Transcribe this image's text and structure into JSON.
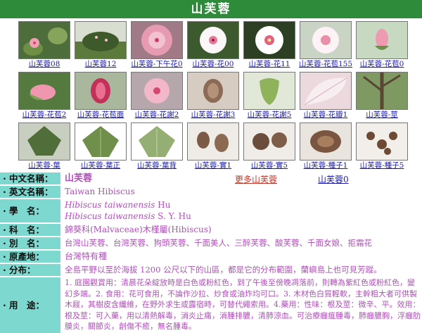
{
  "title": "山芙蓉",
  "gallery": {
    "row1": [
      "山芙蓉08",
      "山芙蓉12",
      "山芙蓉-下午花0",
      "山芙蓉-花00",
      "山芙蓉-花11",
      "山芙蓉-花苞155",
      "山芙蓉-花苞0"
    ],
    "row2": [
      "山芙蓉-花苞2",
      "山芙蓉-花苞面",
      "山芙蓉-花謝2",
      "山芙蓉-花謝3",
      "山芙蓉-花謝5",
      "山芙蓉-花瓣1",
      "山芙蓉-莖"
    ],
    "row3": [
      "山芙蓉-葉",
      "山芙蓉-葉正",
      "山芙蓉-葉背",
      "山芙蓉-實1",
      "山芙蓉-實5",
      "山芙蓉-種子1",
      "山芙蓉-種子5"
    ]
  },
  "links": {
    "more": "更多山芙蓉",
    "zero": "山芙蓉0"
  },
  "info": {
    "chinese_name": {
      "label": "中文名稱：",
      "value": "山芙蓉"
    },
    "english_name": {
      "label": "英文名稱：",
      "value": "Taiwan Hibiscus"
    },
    "scientific_name": {
      "label": "學　名：",
      "line1_italic": "Hibiscus taiwanensis",
      "line1_author": " Hu",
      "line2_italic": "Hibiscus taiwanensis",
      "line2_author": " S. Y. Hu"
    },
    "family": {
      "label": "科　名：",
      "value": "錦葵科(Malvaceae)木槿屬(Hibiscus)"
    },
    "alias": {
      "label": "別　名：",
      "value": "台灣山芙蓉、台灣芙蓉、狗頭芙蓉、千面美人、三醉芙蓉、酸芙蓉、千面女娘、拒霜花"
    },
    "origin": {
      "label": "原產地：",
      "value": "台灣特有種"
    },
    "distribution": {
      "label": "分布：",
      "value": "全島平野以至於海拔 1200 公尺以下的山區，都是它的分布範圍，蘭嶼島上也可見芳蹤。"
    },
    "uses": {
      "label": "用　途：",
      "value": "1. 庭園觀賞用：清晨花朵綻放時是白色或粉紅色，到了午後至傍晚凋落前，則轉為紫紅色或粉紅色，變幻多端。2. 食用：花可食用，不論作沙拉、炒食或油炸均可口。3. 木材色白質輕軟，主幹粗大者可供製木屐，其樹皮含纖維，在野外求生或露宿時，可替代繩索用。4.藥用：性味：根及莖：微辛、平。效用：根及莖：可入藥，用以清熱解毒，消炎止痛，消腫排膿，清肺涼血。可治療癰疽腫毒，肺癰膿胸，浮癰肋膜炎，關節炎，創傷不癒，無名腫毒。"
    }
  },
  "colors": {
    "banner": "#2e8b3a",
    "label_bg": "#7dd9cf",
    "value_text": "#b04fb9",
    "link_red": "#c0392b",
    "link_blue": "#1a1aa8"
  }
}
